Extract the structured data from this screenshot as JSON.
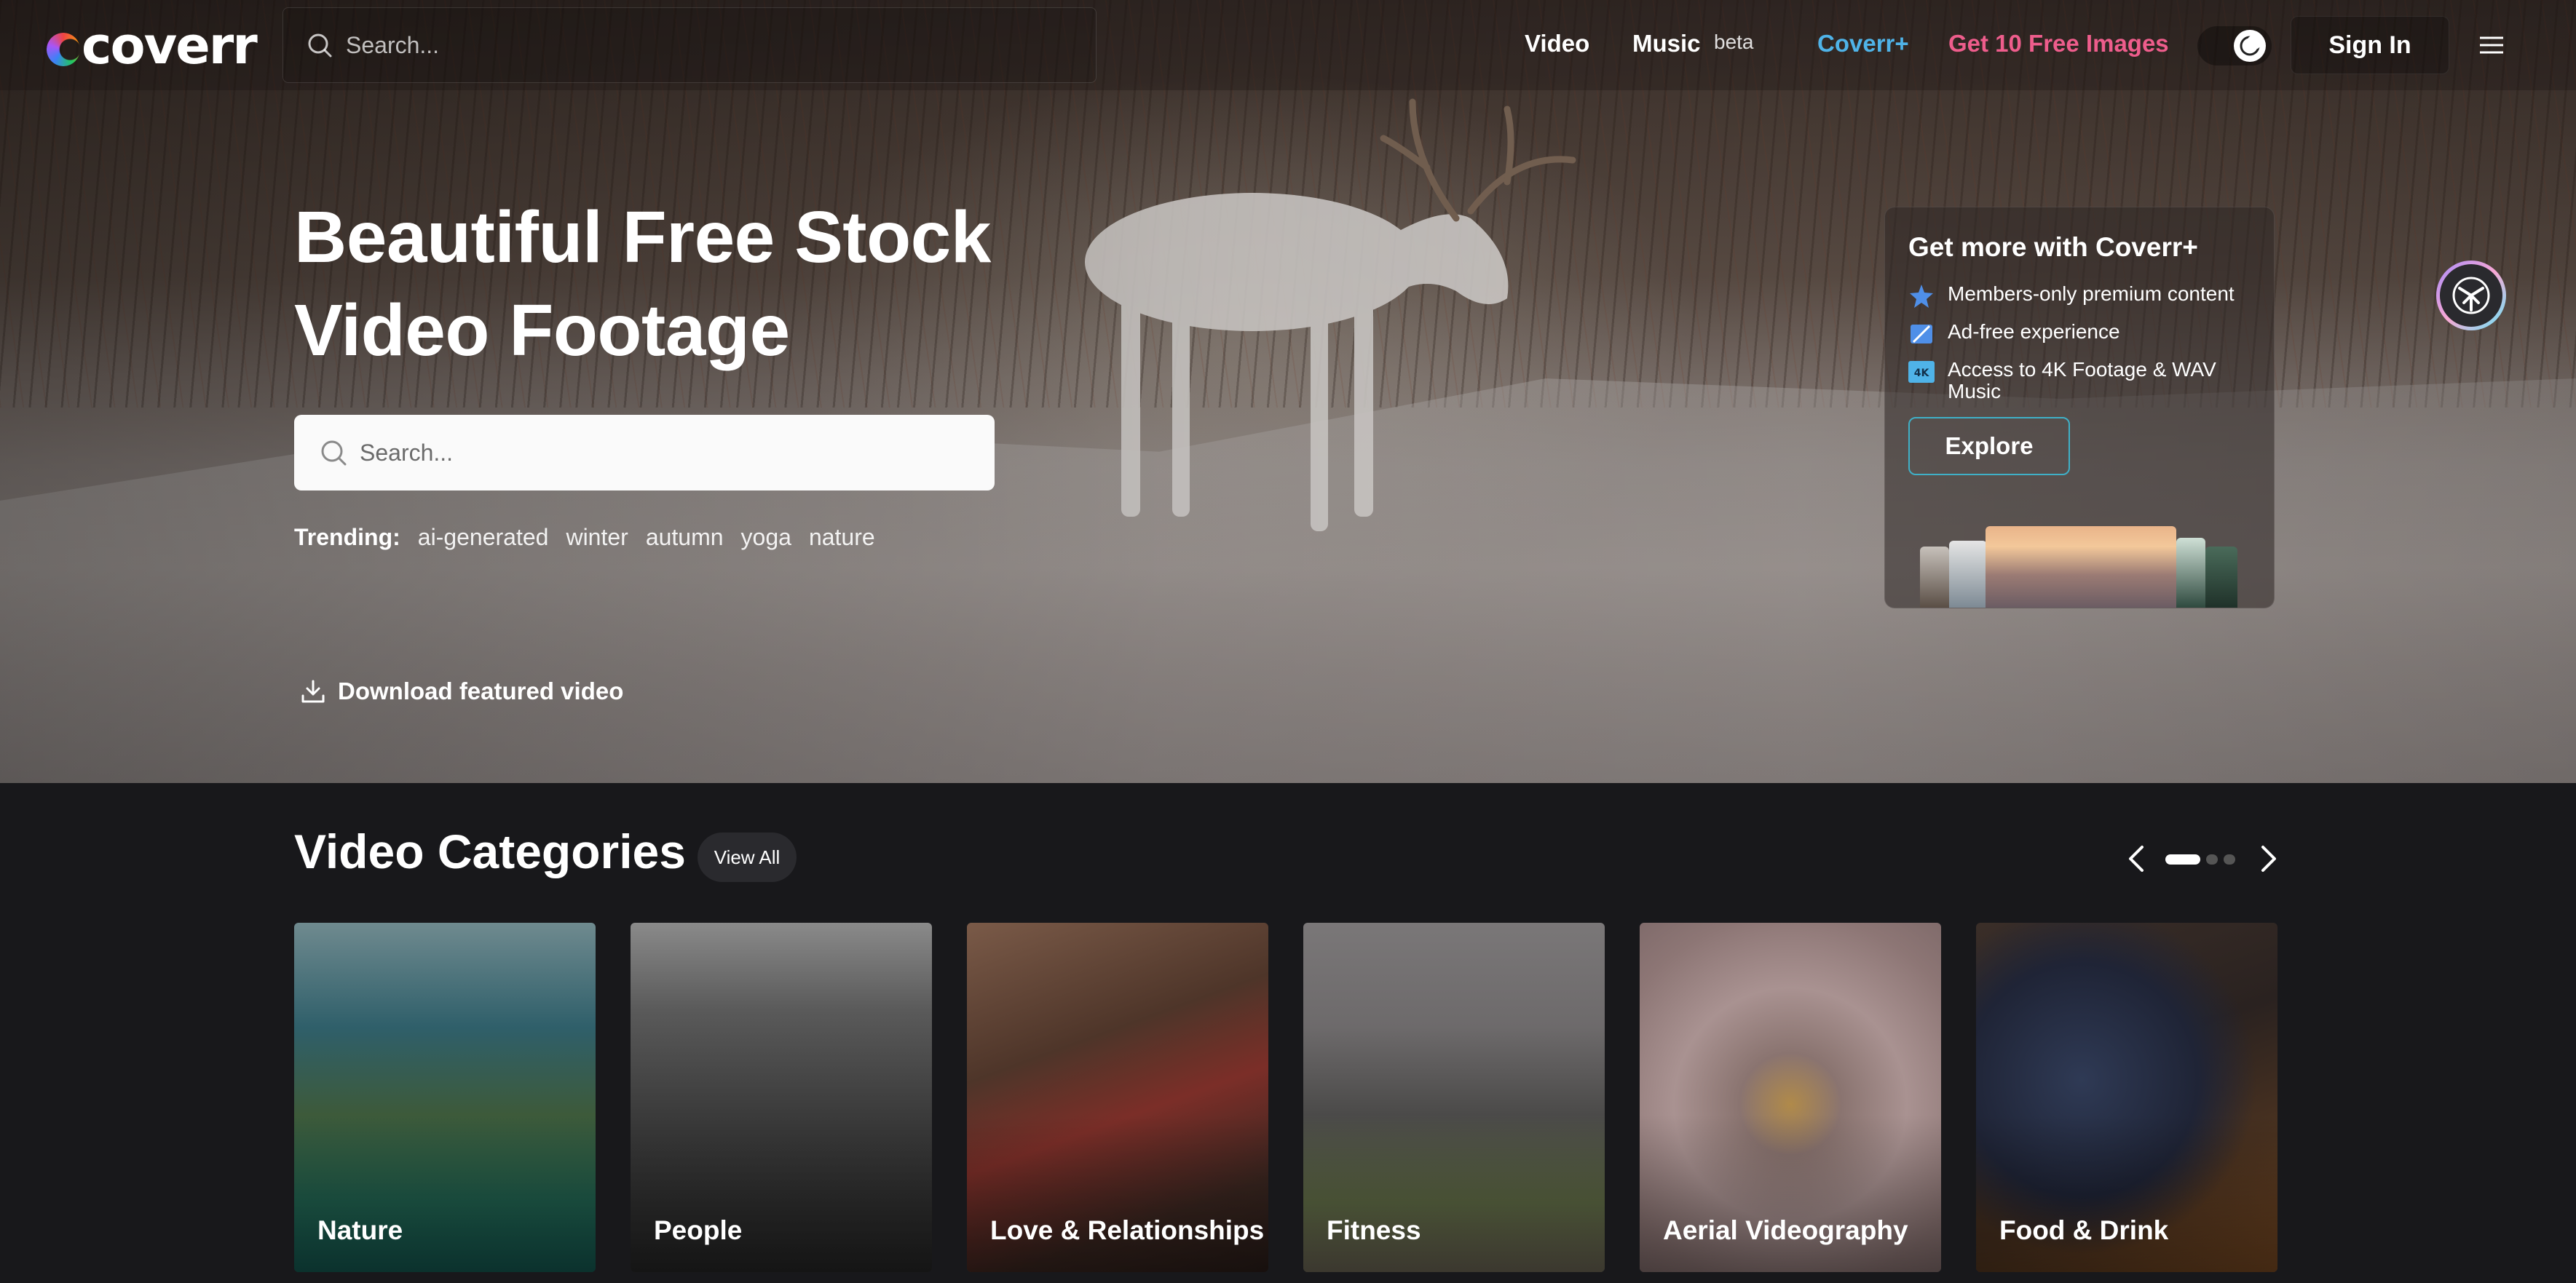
{
  "nav": {
    "logo": "coverr",
    "search_placeholder": "Search...",
    "links": {
      "video": "Video",
      "music": "Music",
      "music_badge": "beta",
      "coverr_plus": "Coverr+",
      "free_images": "Get 10 Free Images"
    },
    "sign_in": "Sign In",
    "colors": {
      "coverr_plus": "#4fb3e8",
      "free_images": "#ee5d8c"
    }
  },
  "hero": {
    "title_line1": "Beautiful Free Stock",
    "title_line2": "Video Footage",
    "search_placeholder": "Search...",
    "trending_label": "Trending:",
    "trending_tags": [
      "ai-generated",
      "winter",
      "autumn",
      "yoga",
      "nature"
    ],
    "download_label": "Download featured video"
  },
  "coverr_plus_card": {
    "title": "Get more with Coverr+",
    "perks": [
      {
        "icon": "star-badge-icon",
        "text": "Members-only premium content"
      },
      {
        "icon": "no-ads-icon",
        "text": "Ad-free experience"
      },
      {
        "icon": "4k-icon",
        "icon_text": "4K",
        "text": "Access to 4K Footage & WAV Music"
      }
    ],
    "explore_button": "Explore"
  },
  "categories": {
    "title": "Video Categories",
    "view_all": "View All",
    "carousel": {
      "pages": 3,
      "current": 1
    },
    "items": [
      {
        "label": "Nature"
      },
      {
        "label": "People"
      },
      {
        "label": "Love & Relationships"
      },
      {
        "label": "Fitness"
      },
      {
        "label": "Aerial Videography"
      },
      {
        "label": "Food & Drink"
      }
    ]
  }
}
